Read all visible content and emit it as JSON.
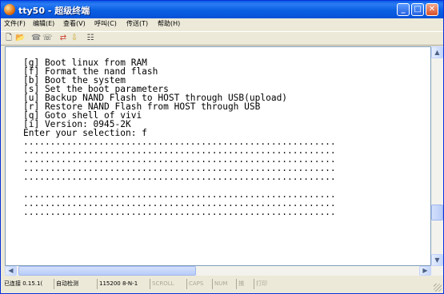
{
  "window": {
    "title": "tty50 - 超级终端",
    "controls": {
      "minimize": "_",
      "maximize": "□",
      "close": "✕"
    }
  },
  "menu": [
    "文件(F)",
    "编辑(E)",
    "查看(V)",
    "呼叫(C)",
    "传送(T)",
    "帮助(H)"
  ],
  "toolbar": {
    "icons": [
      "new-icon",
      "open-icon",
      "disconnect-icon",
      "connect-icon",
      "send-icon",
      "receive-icon",
      "properties-icon"
    ]
  },
  "terminal": {
    "lines": [
      "[g] Boot linux from RAM",
      "[f] Format the nand flash",
      "[b] Boot the system",
      "[s] Set the boot parameters",
      "[u] Backup NAND Flash to HOST through USB(upload)",
      "[r] Restore NAND Flash from HOST through USB",
      "[q] Goto shell of vivi",
      "[i] Version: 0945-2K",
      "Enter your selection: f",
      "..........................................................",
      "..........................................................",
      "..........................................................",
      "..........................................................",
      "..........................................................",
      "",
      "..........................................................",
      "..........................................................",
      ".........................................................."
    ]
  },
  "status": {
    "connection": "已连接 0.15.1(",
    "detect": "自动检测",
    "settings": "115200 8-N-1",
    "scroll": "SCROLL",
    "caps": "CAPS",
    "num": "NUM",
    "capture": "捕",
    "print": "打印"
  }
}
